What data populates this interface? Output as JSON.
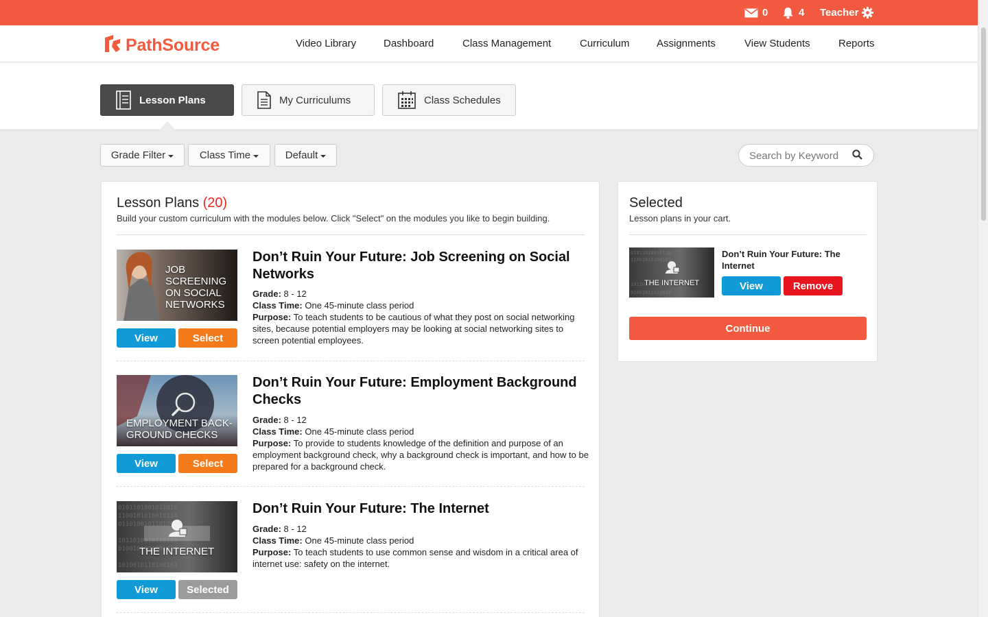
{
  "topbar": {
    "messages_count": "0",
    "notifications_count": "4",
    "user_label": "Teacher"
  },
  "brand": {
    "name": "PathSource",
    "color": "#f15a3f"
  },
  "nav": [
    "Video Library",
    "Dashboard",
    "Class Management",
    "Curriculum",
    "Assignments",
    "View Students",
    "Reports"
  ],
  "tabs": [
    {
      "label": "Lesson Plans",
      "icon": "lesson-plans-icon",
      "active": true
    },
    {
      "label": "My Curriculums",
      "icon": "document-icon",
      "active": false
    },
    {
      "label": "Class Schedules",
      "icon": "calendar-icon",
      "active": false
    }
  ],
  "filters": {
    "grade": "Grade Filter",
    "class_time": "Class Time",
    "sort": "Default",
    "search_placeholder": "Search by Keyword"
  },
  "lesson_plans": {
    "title": "Lesson Plans",
    "count": "(20)",
    "subtitle": "Build your custom curriculum with the modules below. Click \"Select\" on the modules you like to begin building.",
    "grade_label": "Grade:",
    "class_time_label": "Class Time:",
    "purpose_label": "Purpose:",
    "items": [
      {
        "title": "Don’t Ruin Your Future: Job Screening on Social Networks",
        "thumb_text": "JOB SCREENING ON SOCIAL NETWORKS",
        "grade": "8 - 12",
        "class_time": "One 45-minute class period",
        "purpose": "To teach students to be cautious of what they post on social networking sites, because potential employers may be looking at social networking sites to screen potential employees.",
        "view_label": "View",
        "action_label": "Select",
        "selected": false
      },
      {
        "title": "Don’t Ruin Your Future: Employment Background Checks",
        "thumb_text": "EMPLOYMENT BACK-GROUND CHECKS",
        "grade": "8 - 12",
        "class_time": "One 45-minute class period",
        "purpose": "To provide to students knowledge of the definition and purpose of an employment background check, why a background check is important, and how to be prepared for a background check.",
        "view_label": "View",
        "action_label": "Select",
        "selected": false
      },
      {
        "title": "Don’t Ruin Your Future: The Internet",
        "thumb_text": "THE INTERNET",
        "grade": "8 - 12",
        "class_time": "One 45-minute class period",
        "purpose": "To teach students to use common sense and wisdom in a critical area of internet use: safety on the internet.",
        "view_label": "View",
        "action_label": "Selected",
        "selected": true
      }
    ]
  },
  "selected_panel": {
    "title": "Selected",
    "subtitle": "Lesson plans in your cart.",
    "items": [
      {
        "title": "Don’t Ruin Your Future: The Internet",
        "thumb_text": "THE INTERNET",
        "view_label": "View",
        "remove_label": "Remove"
      }
    ],
    "continue_label": "Continue"
  }
}
